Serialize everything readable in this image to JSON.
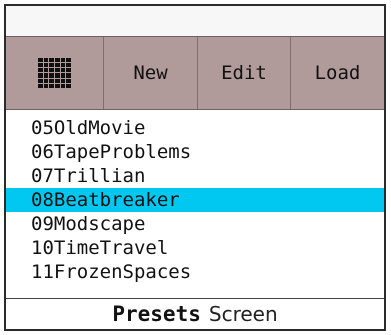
{
  "toolbar": {
    "grid_icon": "grid-icon",
    "buttons": [
      {
        "label": "New"
      },
      {
        "label": "Edit"
      },
      {
        "label": "Load"
      }
    ]
  },
  "presets": {
    "items": [
      {
        "label": "05OldMovie"
      },
      {
        "label": "06TapeProblems"
      },
      {
        "label": "07Trillian"
      },
      {
        "label": "08Beatbreaker"
      },
      {
        "label": "09Modscape"
      },
      {
        "label": "10TimeTravel"
      },
      {
        "label": "11FrozenSpaces"
      }
    ],
    "selected_label": "08Beatbreaker"
  },
  "caption": {
    "title": "Presets",
    "suffix": "Screen"
  },
  "colors": {
    "toolbar_bg": "#b09a9a",
    "selection": "#00c8f0"
  }
}
